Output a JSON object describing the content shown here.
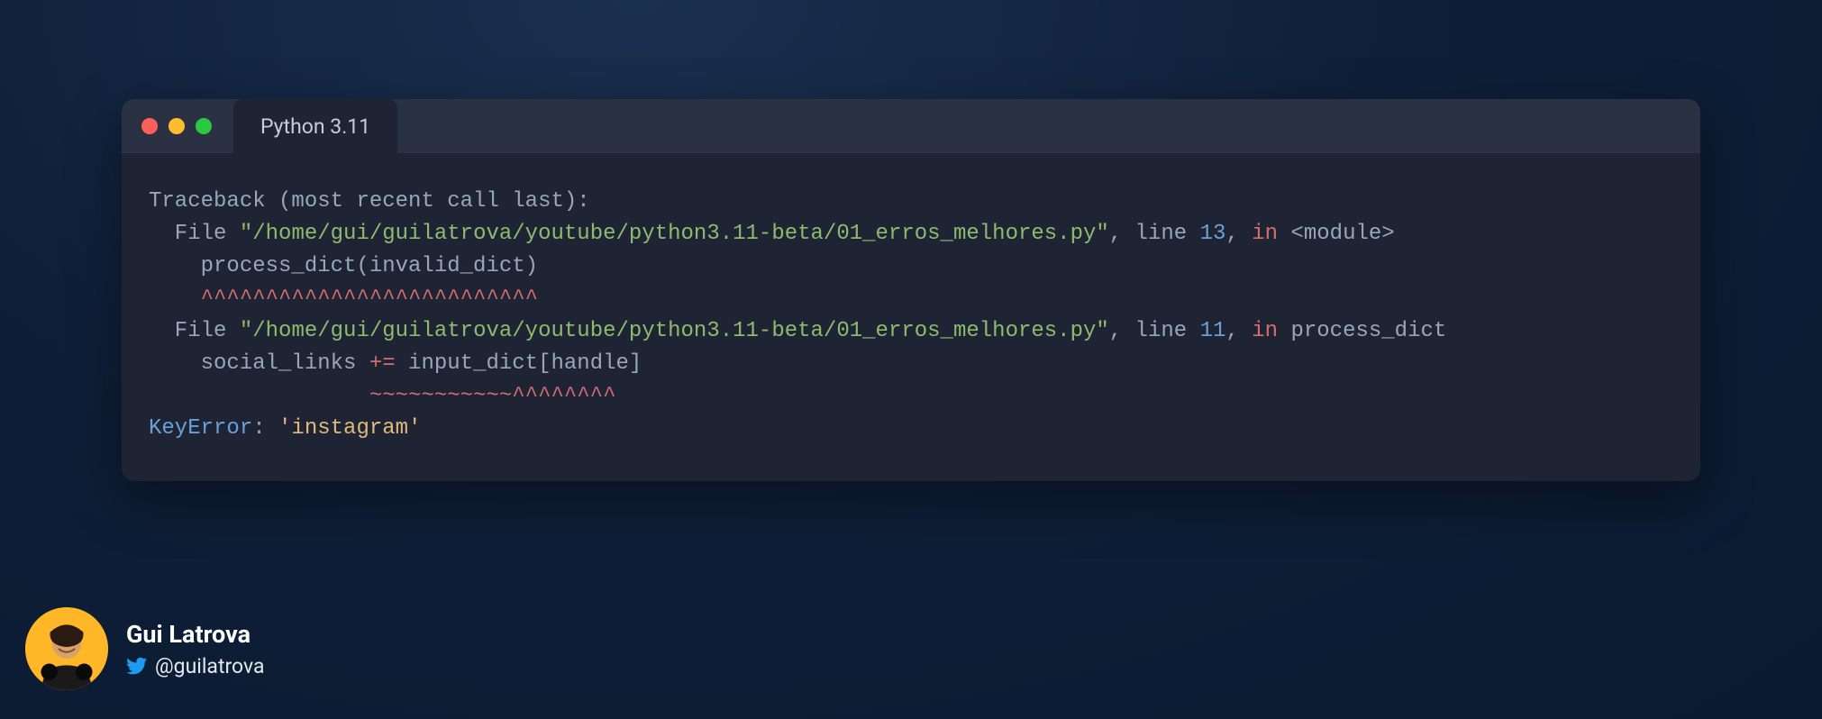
{
  "window": {
    "tab_title": "Python 3.11",
    "traffic_colors": {
      "red": "#ff5f57",
      "yellow": "#febc2e",
      "green": "#28c840"
    }
  },
  "code": {
    "l1": "Traceback (most recent call last):",
    "l2_pre": "  File ",
    "l2_path": "\"/home/gui/guilatrova/youtube/python3.11-beta/01_erros_melhores.py\"",
    "l2_mid1": ", line ",
    "l2_num": "13",
    "l2_mid2": ", ",
    "l2_in": "in",
    "l2_mod": " <module>",
    "l3": "    process_dict(invalid_dict)",
    "l4": "    ^^^^^^^^^^^^^^^^^^^^^^^^^^",
    "l5_pre": "  File ",
    "l5_path": "\"/home/gui/guilatrova/youtube/python3.11-beta/01_erros_melhores.py\"",
    "l5_mid1": ", line ",
    "l5_num": "11",
    "l5_mid2": ", ",
    "l5_in": "in",
    "l5_fn": " process_dict",
    "l6_pre": "    social_links ",
    "l6_op": "+=",
    "l6_post": " input_dict[handle]",
    "l7": "                 ~~~~~~~~~~~^^^^^^^^",
    "l8_err": "KeyError",
    "l8_mid": ": ",
    "l8_val": "'instagram'"
  },
  "author": {
    "name": "Gui Latrova",
    "handle": "@guilatrova"
  }
}
